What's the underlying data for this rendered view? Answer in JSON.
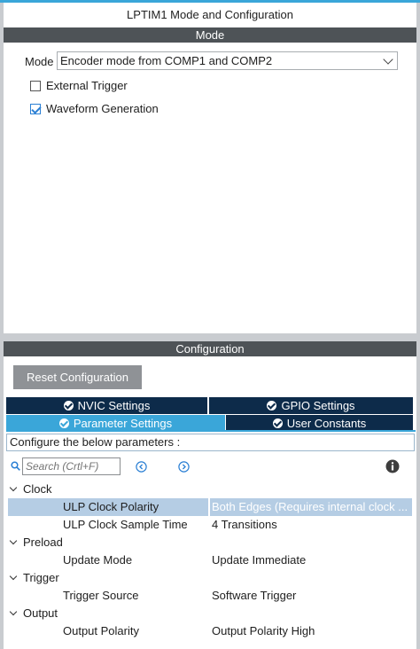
{
  "window": {
    "title": "LPTIM1 Mode and Configuration"
  },
  "mode_section": {
    "header": "Mode",
    "mode_label": "Mode",
    "mode_value": "Encoder mode from COMP1 and COMP2",
    "external_trigger": {
      "label": "External Trigger",
      "checked": false
    },
    "waveform_generation": {
      "label": "Waveform Generation",
      "checked": true
    }
  },
  "config_section": {
    "header": "Configuration",
    "reset_button": "Reset Configuration",
    "tabs": [
      {
        "label": "NVIC Settings",
        "active": false
      },
      {
        "label": "GPIO Settings",
        "active": false
      },
      {
        "label": "Parameter Settings",
        "active": true
      },
      {
        "label": "User Constants",
        "active": false
      }
    ],
    "info_text": "Configure the below parameters :",
    "search_placeholder": "Search (Crtl+F)",
    "groups": [
      {
        "name": "Clock",
        "params": [
          {
            "name": "ULP Clock Polarity",
            "value": "Both Edges (Requires internal clock ...",
            "selected": true
          },
          {
            "name": "ULP Clock Sample Time",
            "value": "4 Transitions",
            "selected": false
          }
        ]
      },
      {
        "name": "Preload",
        "params": [
          {
            "name": "Update Mode",
            "value": "Update Immediate",
            "selected": false
          }
        ]
      },
      {
        "name": "Trigger",
        "params": [
          {
            "name": "Trigger Source",
            "value": "Software Trigger",
            "selected": false
          }
        ]
      },
      {
        "name": "Output",
        "params": [
          {
            "name": "Output Polarity",
            "value": "Output Polarity High",
            "selected": false
          }
        ]
      }
    ]
  },
  "colors": {
    "accent": "#3aa6d9",
    "tab_dark": "#0d2b4a",
    "header_bg": "#4e5357",
    "selection": "#b5cde4"
  }
}
